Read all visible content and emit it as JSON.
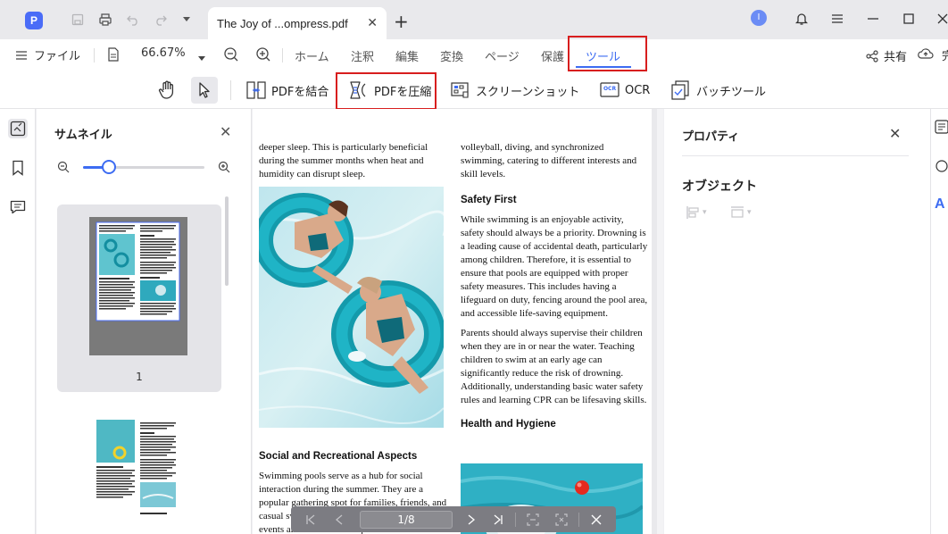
{
  "titlebar": {
    "tab_title": "The Joy of ...ompress.pdf",
    "avatar_letter": "I",
    "app_logo_letter": "P"
  },
  "menubar": {
    "file_label": "ファイル",
    "zoom_value": "66.67%",
    "items": [
      "ホーム",
      "注釈",
      "編集",
      "変換",
      "ページ",
      "保護",
      "ツール"
    ],
    "active_item": "ツール",
    "share_label": "共有",
    "overflow_label": "完"
  },
  "toolbar": {
    "combine_label": "PDFを結合",
    "compress_label": "PDFを圧縮",
    "screenshot_label": "スクリーンショット",
    "ocr_label": "OCR",
    "ocr_badge": "OCR",
    "batch_label": "バッチツール"
  },
  "thumbnails": {
    "title": "サムネイル",
    "page1_num": "1"
  },
  "document": {
    "left_col": {
      "p1": "deeper sleep. This is particularly beneficial during the summer months when heat and humidity can disrupt sleep.",
      "heading": "Social and Recreational Aspects",
      "p2": "Swimming pools serve as a hub for social interaction during the summer. They are a popular gathering spot for families, friends, and casual swimmers. Pools often host community events and activities. The pool"
    },
    "right_col": {
      "p1": "volleyball, diving, and synchronized swimming, catering to different interests and skill levels.",
      "heading1": "Safety First",
      "p2": "While swimming is an enjoyable activity, safety should always be a priority. Drowning is a leading cause of accidental death, particularly among children. Therefore, it is essential to ensure that pools are equipped with proper safety measures. This includes having a lifeguard on duty, fencing around the pool area, and accessible life-saving equipment.",
      "p3": "Parents should always supervise their children when they are in or near the water. Teaching children to swim at an early age can significantly reduce the risk of drowning. Additionally, understanding basic water safety rules and learning CPR can be lifesaving skills.",
      "heading2": "Health and Hygiene"
    }
  },
  "pagenav": {
    "page_display": "1/8"
  },
  "properties": {
    "title": "プロパティ",
    "object_label": "オブジェクト"
  },
  "colors": {
    "accent": "#3d6cf2",
    "highlight_box": "#d81e1e",
    "pool_water": "#3fb8c6"
  }
}
